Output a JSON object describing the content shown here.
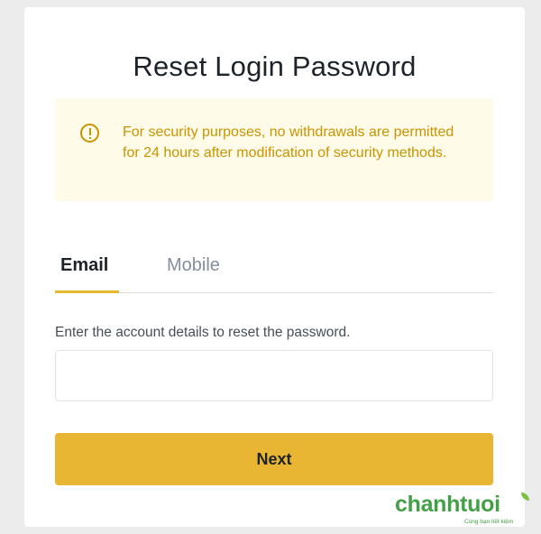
{
  "page": {
    "title": "Reset Login Password"
  },
  "notice": {
    "icon": "exclamation-circle-icon",
    "text": "For security purposes, no withdrawals are permitted for 24 hours after modification of security methods.",
    "color": "#c99400",
    "background": "#fefbe9"
  },
  "tabs": [
    {
      "label": "Email",
      "active": true
    },
    {
      "label": "Mobile",
      "active": false
    }
  ],
  "form": {
    "label": "Enter the account details to reset the password.",
    "input_value": "",
    "input_placeholder": ""
  },
  "actions": {
    "next_label": "Next",
    "accent_color": "#e8b632"
  },
  "watermark": {
    "brand": "chanhtuoi",
    "slogan": "Cùng bạn tiết kiệm"
  }
}
